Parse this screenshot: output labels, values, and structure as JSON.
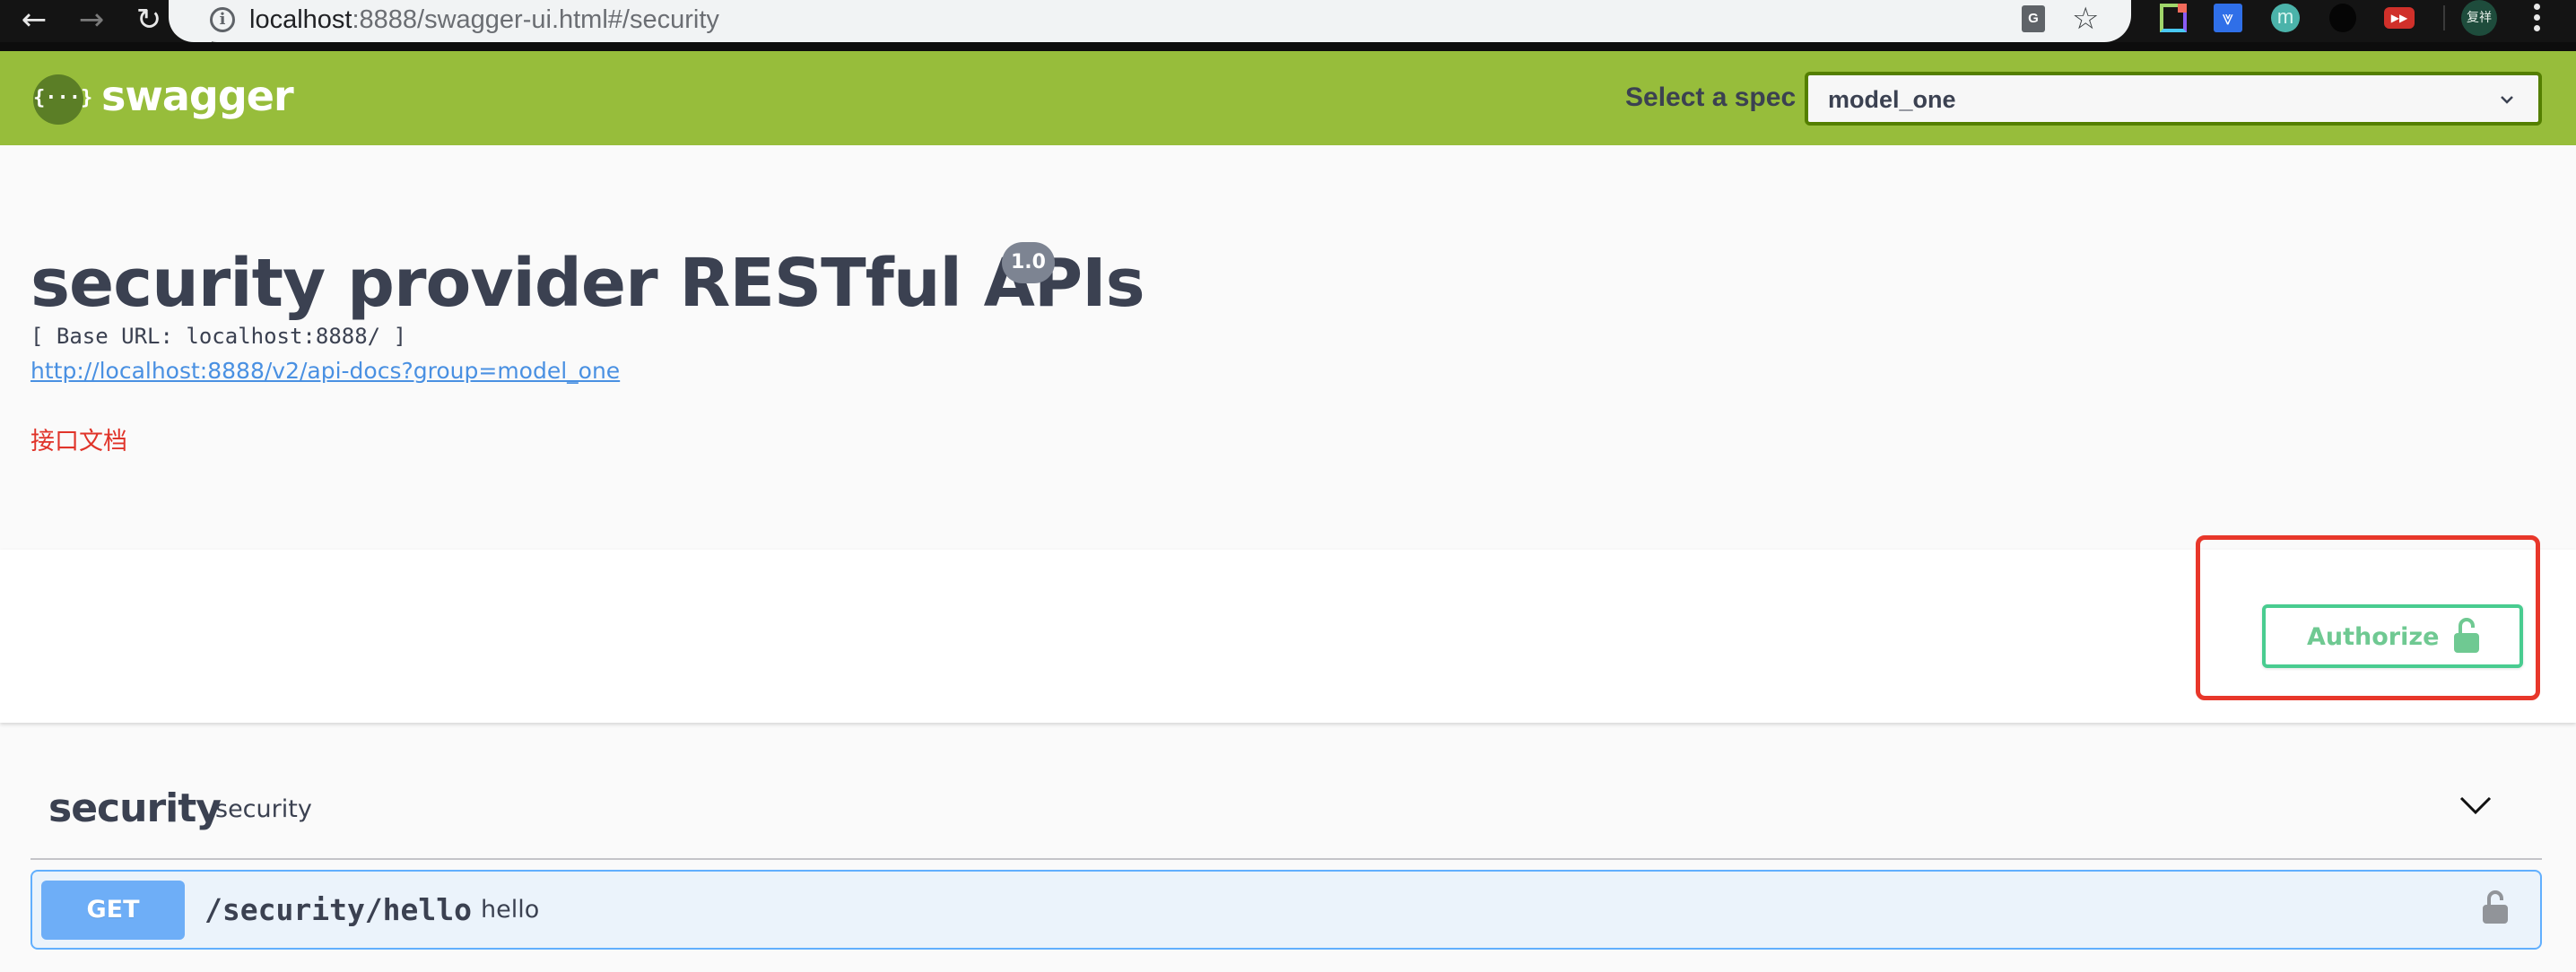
{
  "browser": {
    "nav": {
      "back_glyph": "←",
      "forward_glyph": "→",
      "reload_glyph": "↻"
    },
    "url_host": "localhost",
    "url_rest": ":8888/swagger-ui.html#/security",
    "info_glyph": "i",
    "translate_glyph": "G",
    "star_glyph": "☆",
    "extensions": [
      {
        "name": "doc-extension-icon"
      },
      {
        "name": "download-extension-icon",
        "glyph": "⩔"
      },
      {
        "name": "m-extension-icon",
        "glyph": "m"
      },
      {
        "name": "face-extension-icon"
      },
      {
        "name": "play-extension-icon",
        "glyph": "▶▶"
      }
    ],
    "profile_label": "复祥"
  },
  "topbar": {
    "logo_glyph": "{···}",
    "brand": "swagger",
    "spec_label": "Select a spec",
    "spec_selected": "model_one",
    "brand_color": "#97bd3b"
  },
  "info": {
    "title": "security provider RESTful APIs",
    "version": "1.0",
    "base_url": "[ Base URL: localhost:8888/ ]",
    "docs_link": "http://localhost:8888/v2/api-docs?group=model_one",
    "description": "接口文档"
  },
  "scheme": {
    "authorize_label": "Authorize",
    "authorize_color": "#49cc90",
    "annotation_color": "#e8372a"
  },
  "tags": [
    {
      "name": "security",
      "description": "security",
      "expanded": true,
      "operations": [
        {
          "method": "GET",
          "path": "/security/hello",
          "summary": "hello",
          "method_color": "#61affe",
          "locked": false
        }
      ]
    }
  ]
}
